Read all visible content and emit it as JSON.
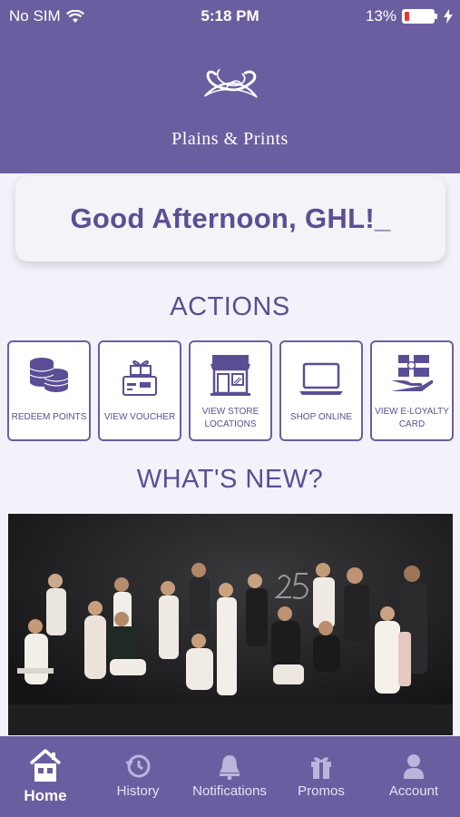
{
  "status": {
    "carrier": "No SIM",
    "time": "5:18 PM",
    "battery": "13%"
  },
  "brand": {
    "name": "Plains & Prints"
  },
  "greeting": "Good Afternoon, GHL!_",
  "sections": {
    "actions": "ACTIONS",
    "whats_new": "WHAT'S NEW?"
  },
  "actions": [
    {
      "label": "REDEEM POINTS",
      "icon": "coins-icon"
    },
    {
      "label": "VIEW VOUCHER",
      "icon": "voucher-icon"
    },
    {
      "label": "VIEW STORE LOCATIONS",
      "icon": "store-icon"
    },
    {
      "label": "SHOP ONLINE",
      "icon": "laptop-icon"
    },
    {
      "label": "VIEW E-LOYALTY CARD",
      "icon": "card-hand-icon"
    }
  ],
  "tabs": [
    {
      "label": "Home",
      "icon": "home-icon",
      "active": true
    },
    {
      "label": "History",
      "icon": "history-icon"
    },
    {
      "label": "Notifications",
      "icon": "bell-icon"
    },
    {
      "label": "Promos",
      "icon": "gift-icon"
    },
    {
      "label": "Account",
      "icon": "user-icon"
    }
  ],
  "colors": {
    "primary": "#6b5ea0",
    "text": "#5b4e95",
    "background": "#f3f2fb"
  }
}
